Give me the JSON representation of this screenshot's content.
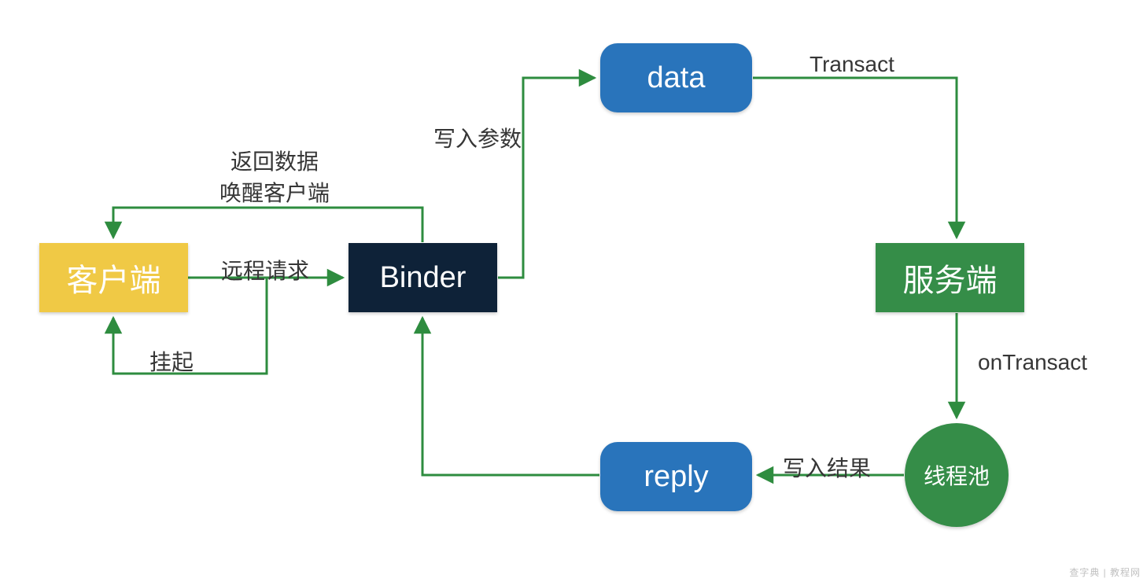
{
  "nodes": {
    "client": {
      "label": "客户端"
    },
    "binder": {
      "label": "Binder"
    },
    "data": {
      "label": "data"
    },
    "reply": {
      "label": "reply"
    },
    "server": {
      "label": "服务端"
    },
    "pool": {
      "label": "线程池"
    }
  },
  "edges": {
    "remote_request": {
      "label": "远程请求"
    },
    "return_data": {
      "line1": "返回数据",
      "line2": "唤醒客户端"
    },
    "suspend": {
      "label": "挂起"
    },
    "write_params": {
      "label": "写入参数"
    },
    "transact": {
      "label": "Transact"
    },
    "on_transact": {
      "label": "onTransact"
    },
    "write_result": {
      "label": "写入结果"
    }
  },
  "colors": {
    "arrow": "#2e8c3f",
    "client_bg": "#f0c945",
    "binder_bg": "#0e2238",
    "bubble_bg": "#2974bb",
    "server_bg": "#358d48"
  },
  "watermark": "查字典 | 教程网"
}
